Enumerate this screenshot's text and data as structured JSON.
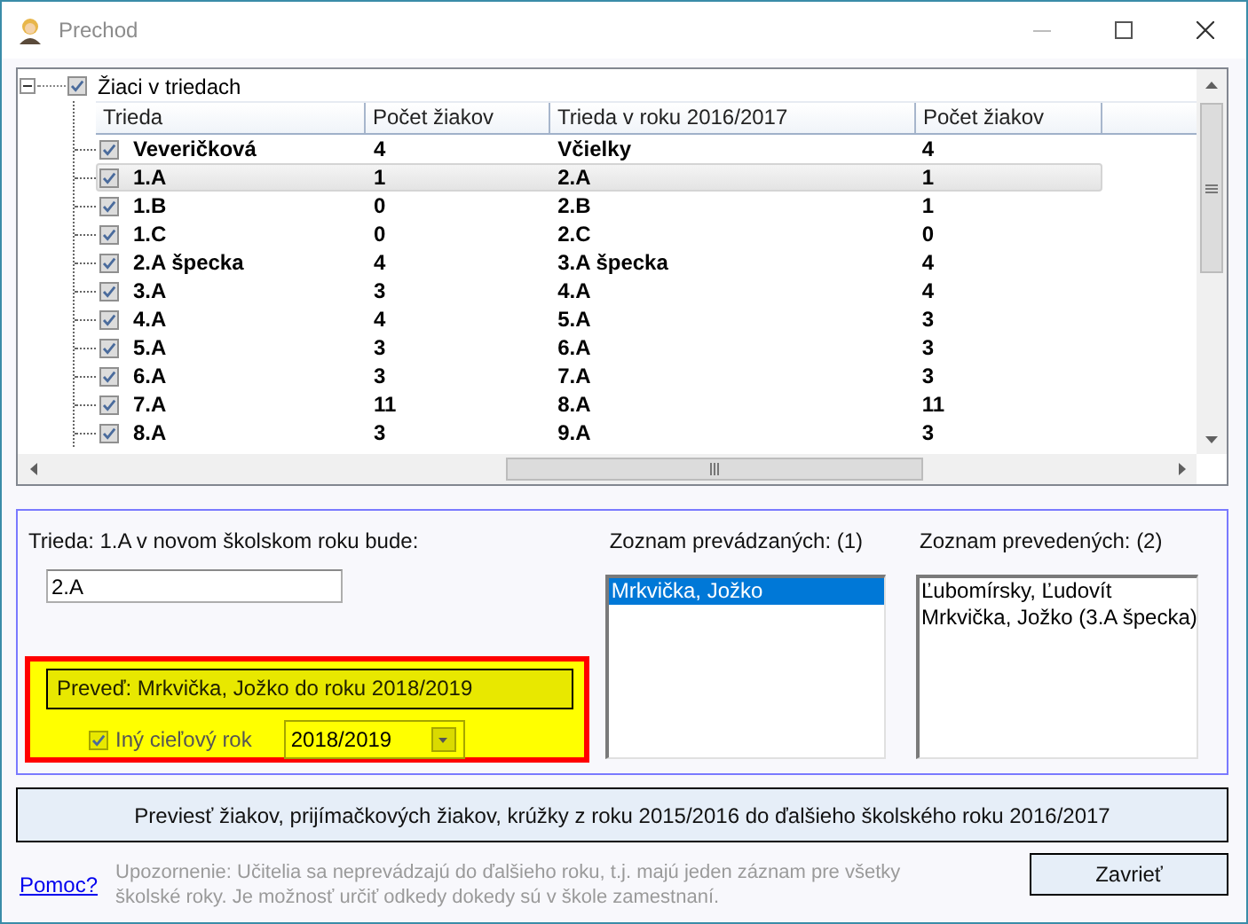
{
  "window": {
    "title": "Prechod"
  },
  "tree": {
    "root": {
      "label": "Žiaci v triedach",
      "checked": true,
      "expanded": true
    },
    "columns": [
      "Trieda",
      "Počet žiakov",
      "Trieda v roku 2016/2017",
      "Počet žiakov"
    ],
    "rows": [
      {
        "cells": [
          "Veveričková",
          "4",
          "Včielky",
          "4"
        ],
        "checked": true,
        "selected": false
      },
      {
        "cells": [
          "1.A",
          "1",
          "2.A",
          "1"
        ],
        "checked": true,
        "selected": true
      },
      {
        "cells": [
          "1.B",
          "0",
          "2.B",
          "1"
        ],
        "checked": true,
        "selected": false
      },
      {
        "cells": [
          "1.C",
          "0",
          "2.C",
          "0"
        ],
        "checked": true,
        "selected": false
      },
      {
        "cells": [
          "2.A špecka",
          "4",
          "3.A špecka",
          "4"
        ],
        "checked": true,
        "selected": false
      },
      {
        "cells": [
          "3.A",
          "3",
          "4.A",
          "4"
        ],
        "checked": true,
        "selected": false
      },
      {
        "cells": [
          "4.A",
          "4",
          "5.A",
          "3"
        ],
        "checked": true,
        "selected": false
      },
      {
        "cells": [
          "5.A",
          "3",
          "6.A",
          "3"
        ],
        "checked": true,
        "selected": false
      },
      {
        "cells": [
          "6.A",
          "3",
          "7.A",
          "3"
        ],
        "checked": true,
        "selected": false
      },
      {
        "cells": [
          "7.A",
          "11",
          "8.A",
          "11"
        ],
        "checked": true,
        "selected": false
      },
      {
        "cells": [
          "8.A",
          "3",
          "9.A",
          "3"
        ],
        "checked": true,
        "selected": false
      }
    ]
  },
  "class_target": {
    "label": "Trieda: 1.A v novom školskom roku bude:",
    "value": "2.A"
  },
  "transfer_notice": {
    "text": "Preveď: Mrkvička, Jožko do roku 2018/2019",
    "other_year": {
      "label": "Iný cieľový rok",
      "checked": true
    },
    "year_select": {
      "value": "2018/2019"
    }
  },
  "pending_list": {
    "label": "Zoznam prevádzaných: (1)",
    "items": [
      {
        "text": "Mrkvička, Jožko",
        "selected": true
      }
    ]
  },
  "done_list": {
    "label": "Zoznam prevedených: (2)",
    "items": [
      {
        "text": "Ľubomírsky, Ľudovít",
        "selected": false
      },
      {
        "text": "Mrkvička, Jožko (3.A špecka)",
        "selected": false
      }
    ]
  },
  "transfer_button": "Previesť žiakov, prijímačkových žiakov, krúžky z roku 2015/2016 do ďalšieho školského roku 2016/2017",
  "help_link": "Pomoc?",
  "note": "Upozornenie: Učitelia sa neprevádzajú do ďalšieho roku, t.j. majú jeden záznam pre všetky školské roky. Je možnosť určiť odkedy dokedy sú v škole zamestnaní.",
  "close_button": "Zavrieť"
}
